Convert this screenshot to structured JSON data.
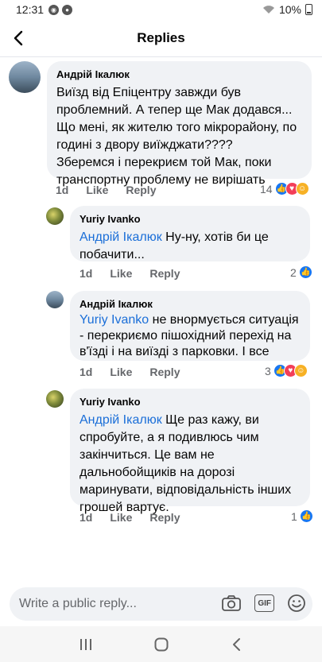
{
  "status_bar": {
    "time": "12:31",
    "battery": "10%"
  },
  "header": {
    "title": "Replies"
  },
  "comments": [
    {
      "author": "Андрій Ікалюк",
      "mention": "",
      "lines": [
        "Виїзд від Епіцентру завжди був",
        "проблемний. А тепер ще Мак додався...",
        "Що мені,  як жителю того мікрорайону, по",
        "годині з двору виїжджати????",
        "Зберемся і перекриєм той Мак,  поки",
        "транспортну проблему не вирішать"
      ],
      "time": "1d",
      "like": "Like",
      "reply": "Reply",
      "reaction_count": "14"
    },
    {
      "author": "Yuriy  Ivanko",
      "mention": "Андрій Ікалюк",
      "lines": [
        " Ну-ну, хотів би це",
        "побачити..."
      ],
      "time": "1d",
      "like": "Like",
      "reply": "Reply",
      "reaction_count": "2"
    },
    {
      "author": "Андрій Ікалюк",
      "mention": "Yuriy  Ivanko",
      "lines": [
        " не внормується ситуація",
        "- перекриємо пішохідний перехід на",
        "в'їзді і на виїзді з парковки. І все"
      ],
      "time": "1d",
      "like": "Like",
      "reply": "Reply",
      "reaction_count": "3"
    },
    {
      "author": "Yuriy  Ivanko",
      "mention": "Андрій Ікалюк",
      "lines": [
        " Ще раз кажу, ви",
        "спробуйте, а я подивлюсь чим",
        "закінчиться. Це вам не",
        "дальнобойщиків на дорозі",
        "маринувати, відповідальність інших",
        "грошей вартує."
      ],
      "time": "1d",
      "like": "Like",
      "reply": "Reply",
      "reaction_count": "1"
    }
  ],
  "composer": {
    "placeholder": "Write a public reply...",
    "gif_label": "GIF"
  },
  "icons": {
    "back": "arrow-left-icon",
    "camera": "camera-icon",
    "emoji": "smiley-icon",
    "nav_recent": "recent-apps-icon",
    "nav_home": "home-icon",
    "nav_back": "nav-back-icon"
  },
  "colors": {
    "mention": "#1a6ed8",
    "bubble": "#f0f2f5",
    "like": "#1877f2",
    "love": "#f33e58",
    "haha": "#f7b125"
  }
}
